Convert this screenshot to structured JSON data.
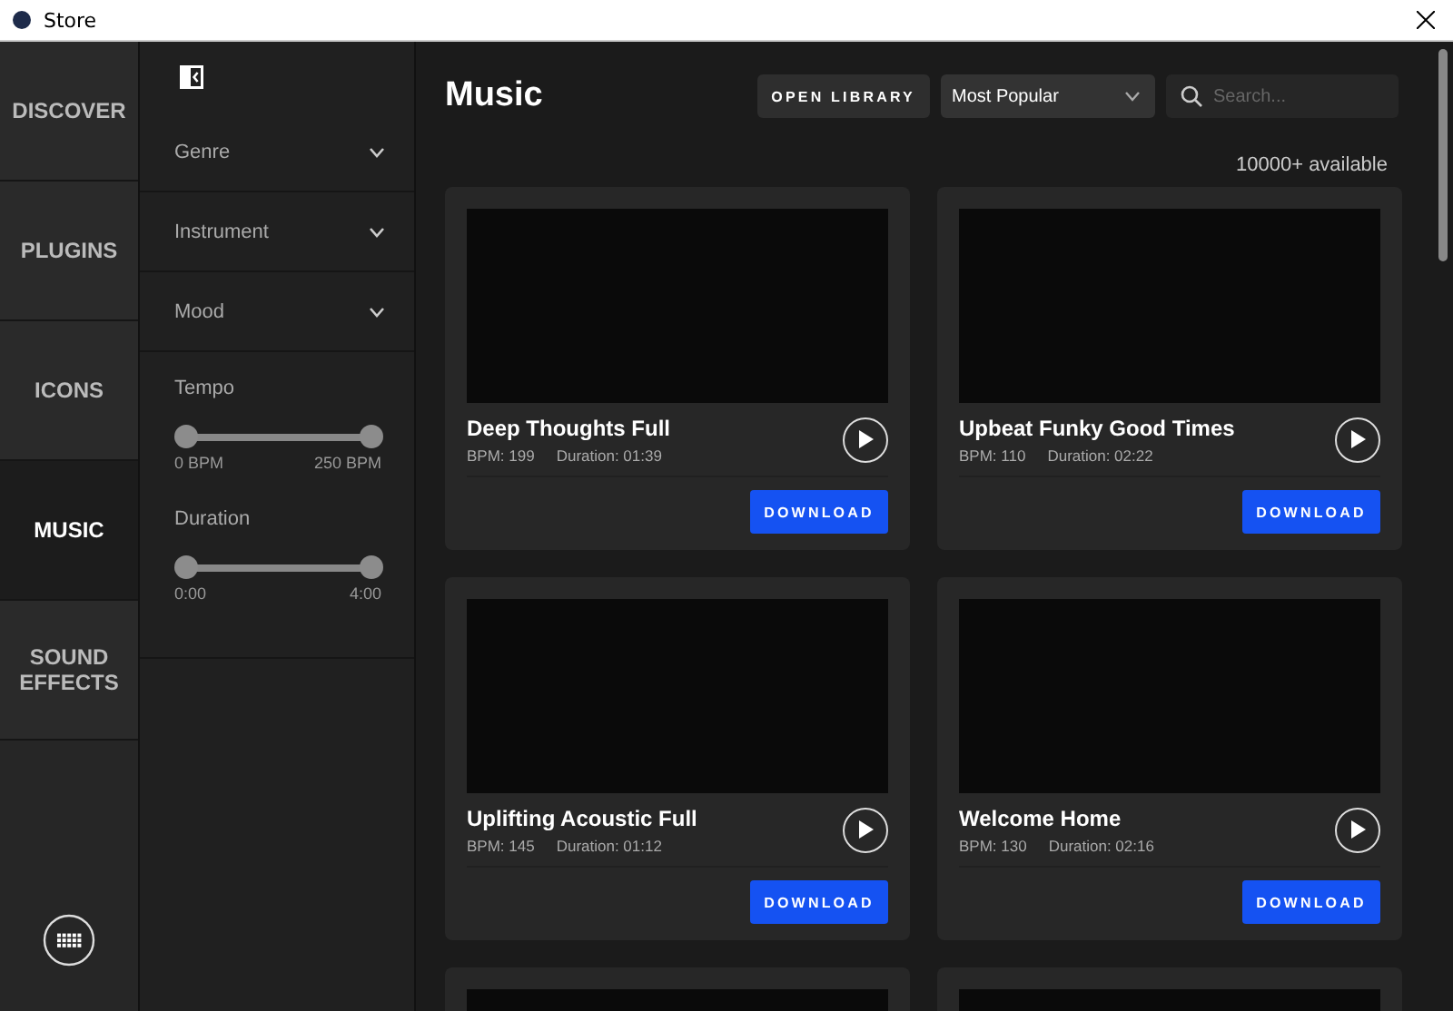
{
  "window": {
    "title": "Store"
  },
  "nav": [
    {
      "label": "DISCOVER",
      "selected": false
    },
    {
      "label": "PLUGINS",
      "selected": false
    },
    {
      "label": "ICONS",
      "selected": false
    },
    {
      "label": "MUSIC",
      "selected": true
    },
    {
      "label": "SOUND EFFECTS",
      "selected": false
    }
  ],
  "filters": {
    "dropdowns": [
      {
        "label": "Genre",
        "expanded": false
      },
      {
        "label": "Instrument",
        "expanded": false
      },
      {
        "label": "Mood",
        "expanded": false
      }
    ],
    "sliders": [
      {
        "label": "Tempo",
        "level": 1,
        "min": "0 BPM",
        "max": "250 BPM"
      },
      {
        "label": "Duration",
        "level": 1,
        "min": "0:00",
        "max": "4:00"
      }
    ]
  },
  "main": {
    "title": "Music",
    "open_library": "OPEN LIBRARY",
    "sort": "Most Popular",
    "search": {
      "placeholder": "Search..."
    },
    "count": "10000+ available",
    "cards": [
      {
        "kind": "track",
        "title": "Deep Thoughts Full",
        "bpm": "BPM: 199",
        "duration": "Duration: 01:39",
        "button": "DOWNLOAD"
      },
      {
        "kind": "track",
        "title": "Upbeat Funky Good Times",
        "bpm": "BPM: 110",
        "duration": "Duration: 02:22",
        "button": "DOWNLOAD"
      },
      {
        "kind": "track",
        "title": "Uplifting Acoustic Full",
        "bpm": "BPM: 145",
        "duration": "Duration: 01:12",
        "button": "DOWNLOAD"
      },
      {
        "kind": "track",
        "title": "Welcome Home",
        "bpm": "BPM: 130",
        "duration": "Duration: 02:16",
        "button": "DOWNLOAD"
      },
      {
        "kind": "partial"
      },
      {
        "kind": "partial"
      }
    ]
  }
}
